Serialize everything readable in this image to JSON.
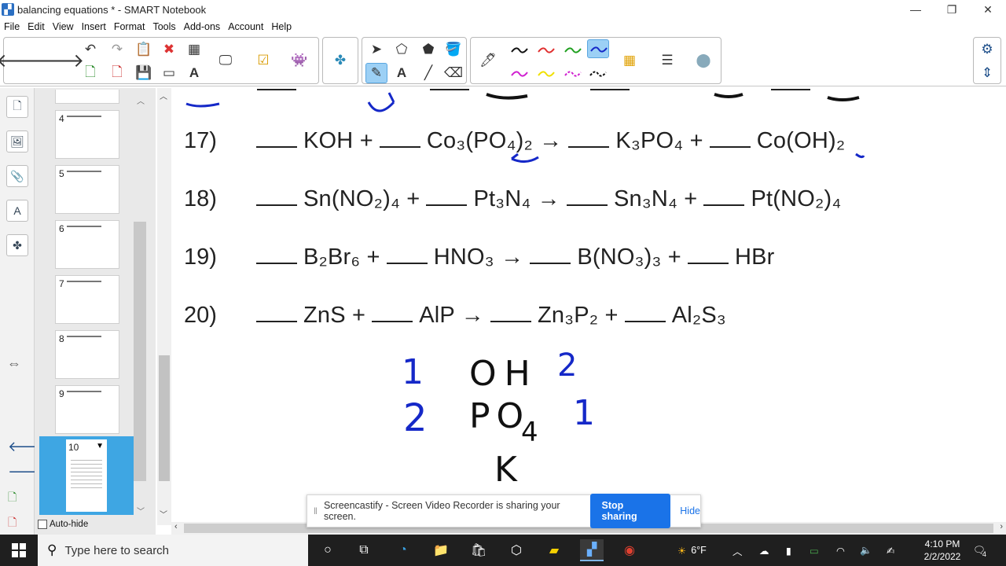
{
  "window": {
    "title": "balancing equations * - SMART Notebook",
    "minimize": "—",
    "maximize": "❐",
    "close": "✕"
  },
  "menu": [
    "File",
    "Edit",
    "View",
    "Insert",
    "Format",
    "Tools",
    "Add-ons",
    "Account",
    "Help"
  ],
  "sorter": {
    "pages": [
      "4",
      "5",
      "6",
      "7",
      "8",
      "9"
    ],
    "active_page": "10",
    "autohide_label": "Auto-hide"
  },
  "equations": [
    {
      "num": "17)",
      "parts": [
        "KOH +",
        "Co₃(PO₄)₂ →",
        "K₃PO₄ +",
        "Co(OH)₂"
      ]
    },
    {
      "num": "18)",
      "parts": [
        "Sn(NO₂)₄ +",
        "Pt₃N₄ →",
        "Sn₃N₄ +",
        "Pt(NO₂)₄"
      ]
    },
    {
      "num": "19)",
      "parts": [
        "B₂Br₆ +",
        "HNO₃ →",
        "B(NO₃)₃ +",
        "HBr"
      ]
    },
    {
      "num": "20)",
      "parts": [
        "ZnS +",
        "AlP →",
        "Zn₃P₂ +",
        "Al₂S₃"
      ]
    }
  ],
  "handwriting": {
    "left_numbers": [
      "1",
      "2"
    ],
    "ions": [
      "OH",
      "PO",
      "4",
      "K"
    ],
    "right_numbers": [
      "2",
      "1"
    ]
  },
  "screencastify": {
    "message": "Screencastify - Screen Video Recorder is sharing your screen.",
    "stop_label": "Stop sharing",
    "hide_label": "Hide"
  },
  "taskbar": {
    "search_placeholder": "Type here to search",
    "weather": "6°F",
    "time": "4:10 PM",
    "date": "2/2/2022",
    "notifications": "4"
  },
  "colors": {
    "accent": "#1a73e8",
    "ink_blue": "#1528c8",
    "ink_black": "#111111",
    "active_thumb": "#3ea6e3"
  }
}
